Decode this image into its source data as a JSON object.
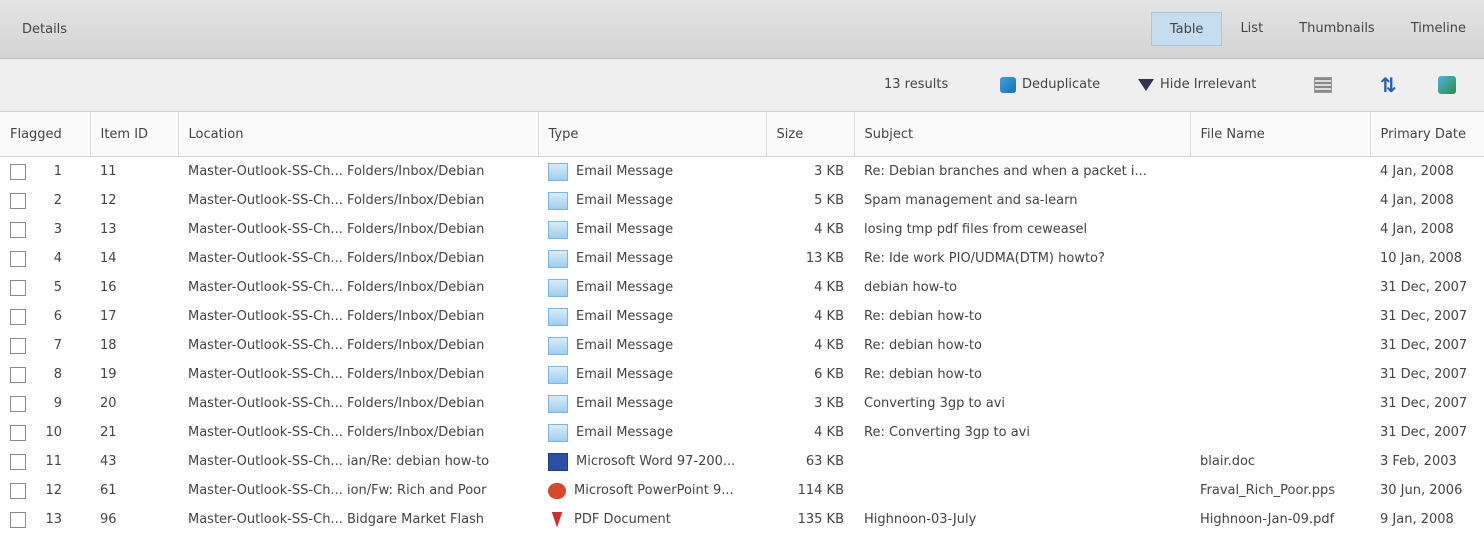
{
  "header": {
    "title": "Details",
    "view_tabs": [
      "Table",
      "List",
      "Thumbnails",
      "Timeline"
    ]
  },
  "toolbar": {
    "results": "13 results",
    "deduplicate": "Deduplicate",
    "hide_irrelevant": "Hide Irrelevant"
  },
  "columns": [
    "Flagged",
    "Item ID",
    "Location",
    "Type",
    "Size",
    "Subject",
    "File Name",
    "Primary Date"
  ],
  "rows": [
    {
      "n": "1",
      "id": "11",
      "location": "Master-Outlook-SS-Ch... Folders/Inbox/Debian",
      "type": "Email Message",
      "icon": "email-icon",
      "size": "3 KB",
      "subject": "Re: Debian branches and when a packet i...",
      "file": "",
      "date": "4 Jan, 2008"
    },
    {
      "n": "2",
      "id": "12",
      "location": "Master-Outlook-SS-Ch... Folders/Inbox/Debian",
      "type": "Email Message",
      "icon": "email-icon",
      "size": "5 KB",
      "subject": "Spam management and sa-learn",
      "file": "",
      "date": "4 Jan, 2008"
    },
    {
      "n": "3",
      "id": "13",
      "location": "Master-Outlook-SS-Ch... Folders/Inbox/Debian",
      "type": "Email Message",
      "icon": "email-icon",
      "size": "4 KB",
      "subject": "losing tmp pdf files from ceweasel",
      "file": "",
      "date": "4 Jan, 2008"
    },
    {
      "n": "4",
      "id": "14",
      "location": "Master-Outlook-SS-Ch... Folders/Inbox/Debian",
      "type": "Email Message",
      "icon": "email-icon",
      "size": "13 KB",
      "subject": "Re: Ide work PIO/UDMA(DTM) howto?",
      "file": "",
      "date": "10 Jan, 2008"
    },
    {
      "n": "5",
      "id": "16",
      "location": "Master-Outlook-SS-Ch... Folders/Inbox/Debian",
      "type": "Email Message",
      "icon": "email-icon",
      "size": "4 KB",
      "subject": "debian how-to",
      "file": "",
      "date": "31 Dec, 2007"
    },
    {
      "n": "6",
      "id": "17",
      "location": "Master-Outlook-SS-Ch... Folders/Inbox/Debian",
      "type": "Email Message",
      "icon": "email-icon",
      "size": "4 KB",
      "subject": "Re: debian how-to",
      "file": "",
      "date": "31 Dec, 2007"
    },
    {
      "n": "7",
      "id": "18",
      "location": "Master-Outlook-SS-Ch... Folders/Inbox/Debian",
      "type": "Email Message",
      "icon": "email-icon",
      "size": "4 KB",
      "subject": "Re: debian how-to",
      "file": "",
      "date": "31 Dec, 2007"
    },
    {
      "n": "8",
      "id": "19",
      "location": "Master-Outlook-SS-Ch... Folders/Inbox/Debian",
      "type": "Email Message",
      "icon": "email-icon",
      "size": "6 KB",
      "subject": "Re: debian how-to",
      "file": "",
      "date": "31 Dec, 2007"
    },
    {
      "n": "9",
      "id": "20",
      "location": "Master-Outlook-SS-Ch... Folders/Inbox/Debian",
      "type": "Email Message",
      "icon": "email-icon",
      "size": "3 KB",
      "subject": "Converting 3gp to avi",
      "file": "",
      "date": "31 Dec, 2007"
    },
    {
      "n": "10",
      "id": "21",
      "location": "Master-Outlook-SS-Ch... Folders/Inbox/Debian",
      "type": "Email Message",
      "icon": "email-icon",
      "size": "4 KB",
      "subject": "Re: Converting 3gp to avi",
      "file": "",
      "date": "31 Dec, 2007"
    },
    {
      "n": "11",
      "id": "43",
      "location": "Master-Outlook-SS-Ch... ian/Re: debian how-to",
      "type": "Microsoft Word 97-200...",
      "icon": "word-icon",
      "size": "63 KB",
      "subject": "",
      "file": "blair.doc",
      "date": "3 Feb, 2003"
    },
    {
      "n": "12",
      "id": "61",
      "location": "Master-Outlook-SS-Ch... ion/Fw: Rich and Poor",
      "type": "Microsoft PowerPoint 9...",
      "icon": "ppt-icon",
      "size": "114 KB",
      "subject": "",
      "file": "Fraval_Rich_Poor.pps",
      "date": "30 Jun, 2006"
    },
    {
      "n": "13",
      "id": "96",
      "location": "Master-Outlook-SS-Ch... Bidgare Market Flash",
      "type": "PDF Document",
      "icon": "pdf-icon",
      "size": "135 KB",
      "subject": "Highnoon-03-July",
      "file": "Highnoon-Jan-09.pdf",
      "date": "9 Jan, 2008"
    }
  ]
}
